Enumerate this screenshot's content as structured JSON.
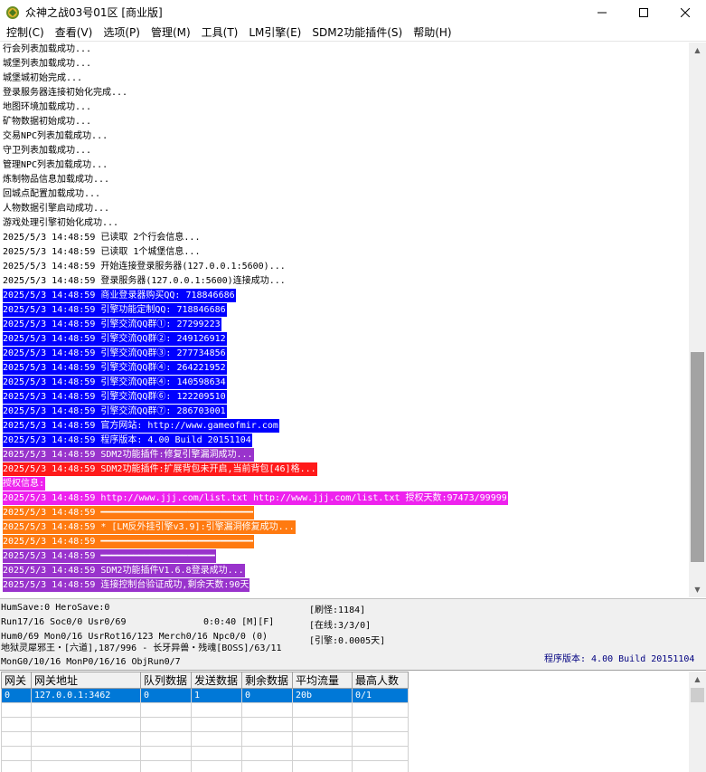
{
  "window": {
    "title": "众神之战03号01区 [商业版]"
  },
  "menu": [
    "控制(C)",
    "查看(V)",
    "选项(P)",
    "管理(M)",
    "工具(T)",
    "LM引擎(E)",
    "SDM2功能插件(S)",
    "帮助(H)"
  ],
  "log": [
    {
      "text": "行会列表加载成功...",
      "hl": ""
    },
    {
      "text": "城堡列表加载成功...",
      "hl": ""
    },
    {
      "text": "城堡城初始完成...",
      "hl": ""
    },
    {
      "text": "登录服务器连接初始化完成...",
      "hl": ""
    },
    {
      "text": "地图环境加载成功...",
      "hl": ""
    },
    {
      "text": "矿物数据初始成功...",
      "hl": ""
    },
    {
      "text": "交易NPC列表加载成功...",
      "hl": ""
    },
    {
      "text": "守卫列表加载成功...",
      "hl": ""
    },
    {
      "text": "管理NPC列表加载成功...",
      "hl": ""
    },
    {
      "text": "炼制物品信息加载成功...",
      "hl": ""
    },
    {
      "text": "回城点配置加载成功...",
      "hl": ""
    },
    {
      "text": "人物数据引擎启动成功...",
      "hl": ""
    },
    {
      "text": "游戏处理引擎初始化成功...",
      "hl": ""
    },
    {
      "text": "2025/5/3 14:48:59 已读取 2个行会信息...",
      "hl": ""
    },
    {
      "text": "2025/5/3 14:48:59 已读取 1个城堡信息...",
      "hl": ""
    },
    {
      "text": "2025/5/3 14:48:59 开始连接登录服务器(127.0.0.1:5600)...",
      "hl": ""
    },
    {
      "text": "2025/5/3 14:48:59 登录服务器(127.0.0.1:5600)连接成功...",
      "hl": ""
    },
    {
      "text": "2025/5/3 14:48:59 商业登录器购买QQ: 718846686",
      "hl": "blue"
    },
    {
      "text": "2025/5/3 14:48:59 引擎功能定制QQ: 718846686",
      "hl": "blue"
    },
    {
      "text": "2025/5/3 14:48:59 引擎交流QQ群①: 27299223",
      "hl": "blue"
    },
    {
      "text": "2025/5/3 14:48:59 引擎交流QQ群②: 249126912",
      "hl": "blue"
    },
    {
      "text": "2025/5/3 14:48:59 引擎交流QQ群③: 277734856",
      "hl": "blue"
    },
    {
      "text": "2025/5/3 14:48:59 引擎交流QQ群④: 264221952",
      "hl": "blue"
    },
    {
      "text": "2025/5/3 14:48:59 引擎交流QQ群④: 140598634",
      "hl": "blue"
    },
    {
      "text": "2025/5/3 14:48:59 引擎交流QQ群⑥: 122209510",
      "hl": "blue"
    },
    {
      "text": "2025/5/3 14:48:59 引擎交流QQ群⑦: 286703001",
      "hl": "blue"
    },
    {
      "text": "2025/5/3 14:48:59 官方网站: http://www.gameofmir.com",
      "hl": "blue"
    },
    {
      "text": "2025/5/3 14:48:59 程序版本: 4.00 Build 20151104",
      "hl": "blue"
    },
    {
      "text": "2025/5/3 14:48:59 SDM2功能插件:修复引擎漏洞成功...",
      "hl": "purple"
    },
    {
      "text": "2025/5/3 14:48:59 SDM2功能插件:扩展背包未开启,当前背包[46]格...",
      "hl": "red"
    },
    {
      "text": "授权信息:",
      "hl": "magenta"
    },
    {
      "text": "2025/5/3 14:48:59 http://www.jjj.com/list.txt http://www.jjj.com/list.txt 授权天数:97473/99999",
      "hl": "magenta"
    },
    {
      "text": "2025/5/3 14:48:59 ━━━━━━━━━━━━━━━━━━━━━━━━━━━━",
      "hl": "orange"
    },
    {
      "text": "2025/5/3 14:48:59 * [LM反外挂引擎v3.9]:引擎漏洞修复成功...",
      "hl": "orange"
    },
    {
      "text": "2025/5/3 14:48:59 ━━━━━━━━━━━━━━━━━━━━━━━━━━━━",
      "hl": "orange"
    },
    {
      "text": "2025/5/3 14:48:59 ━━━━━━━━━━━━━━━━━━━━━",
      "hl": "purple"
    },
    {
      "text": "2025/5/3 14:48:59 SDM2功能插件V1.6.8登录成功...",
      "hl": "purple"
    },
    {
      "text": "2025/5/3 14:48:59 连接控制台验证成功,剩余天数:90天",
      "hl": "purple"
    }
  ],
  "status": {
    "line1": "HumSave:0 HeroSave:0",
    "line2": "Run17/16 Soc0/0 Usr0/69",
    "timer": "0:0:40 [M][F]",
    "line3": "Hum0/69 Mon0/16 UsrRot16/123 Merch0/16 Npc0/0 (0)",
    "line4": "地狱灵犀邪王・[六道],187/996 - 长牙异兽・残魂[BOSS]/63/11",
    "line5": "MonG0/10/16 MonP0/16/16 ObjRun0/7",
    "box1": "[刷怪:1184]",
    "box2": "[在线:3/3/0]",
    "box3": "[引擎:0.0005天]",
    "version": "程序版本: 4.00 Build 20151104"
  },
  "gateways": {
    "columns": [
      "网关",
      "网关地址",
      "队列数据",
      "发送数据",
      "剩余数据",
      "平均流量",
      "最高人数"
    ],
    "rows": [
      [
        "0",
        "127.0.0.1:3462",
        "0",
        "1",
        "0",
        "20b",
        "0/1"
      ],
      [
        "",
        "",
        "",
        "",
        "",
        "",
        ""
      ],
      [
        "",
        "",
        "",
        "",
        "",
        "",
        ""
      ],
      [
        "",
        "",
        "",
        "",
        "",
        "",
        ""
      ],
      [
        "",
        "",
        "",
        "",
        "",
        "",
        ""
      ],
      [
        "",
        "",
        "",
        "",
        "",
        "",
        ""
      ]
    ]
  },
  "colors": {
    "blue": "#0000ff",
    "purple": "#9933cc",
    "red": "#ff1a1a",
    "magenta": "#ee22ee",
    "orange": "#ff7a10",
    "selection": "#0078d7"
  }
}
